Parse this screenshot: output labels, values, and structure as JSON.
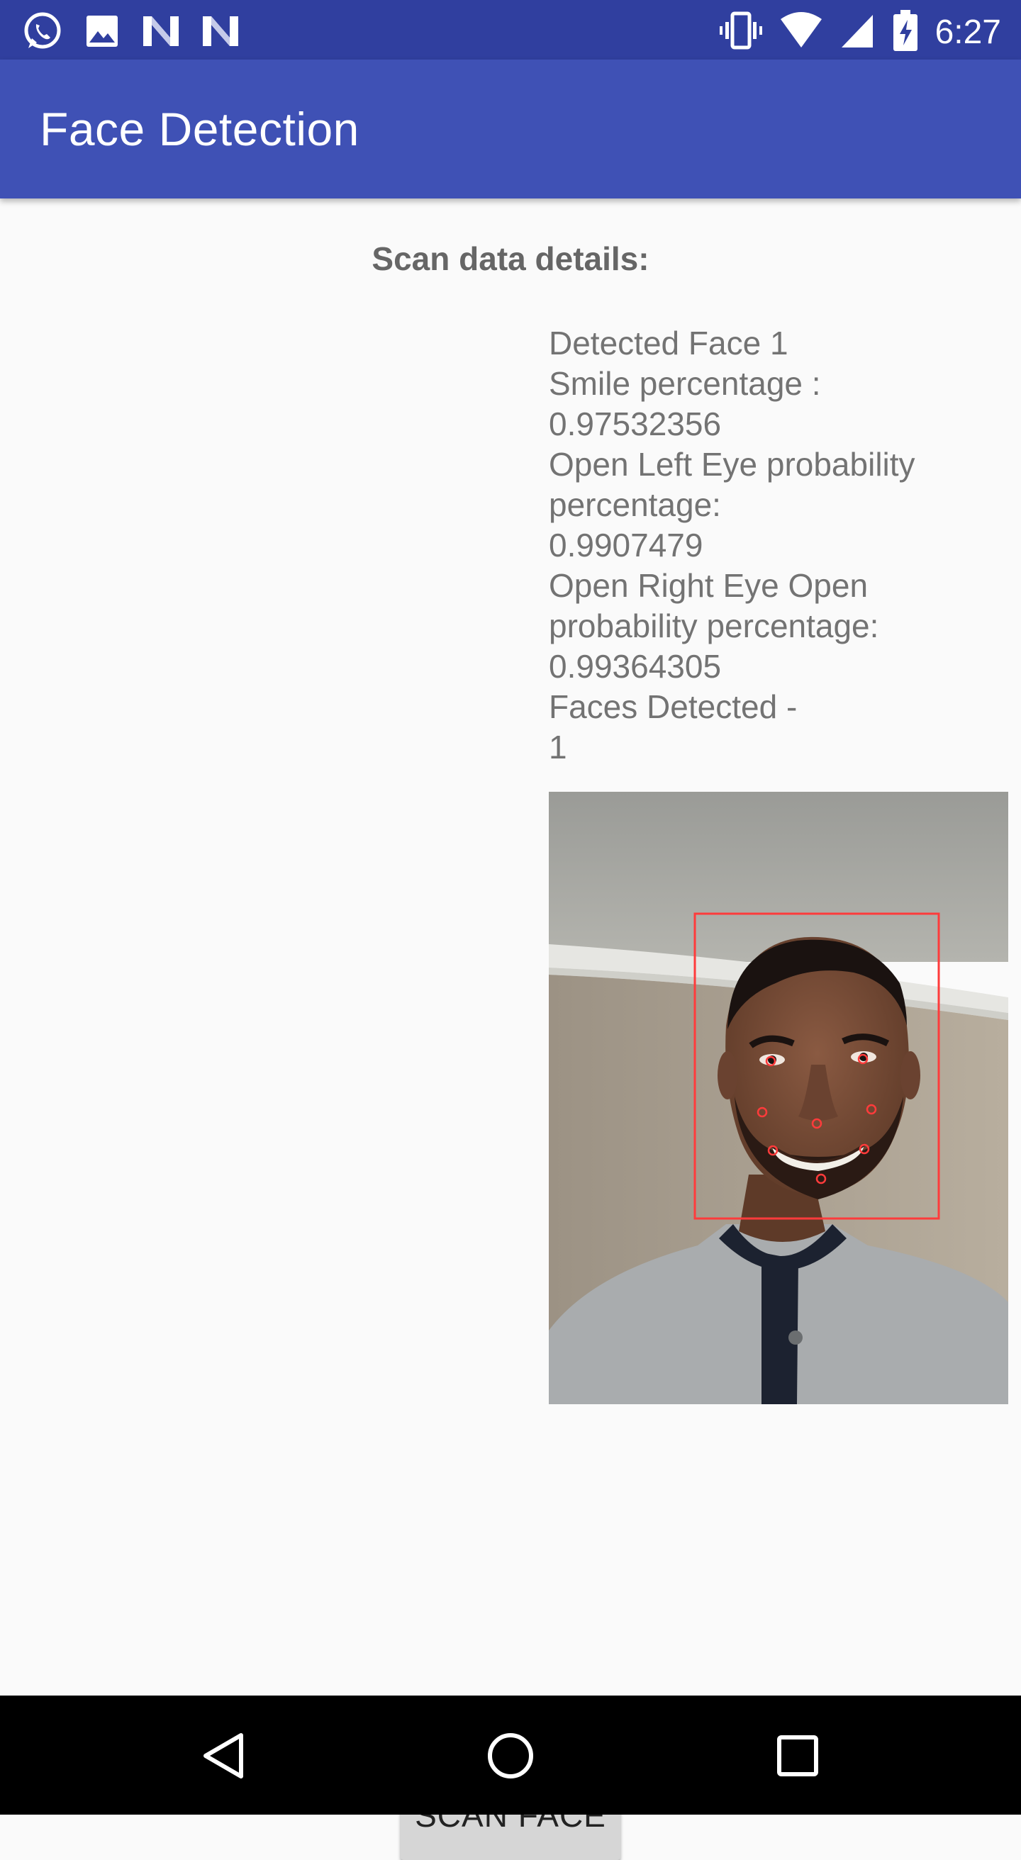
{
  "status_bar": {
    "time": "6:27",
    "left_icons": [
      "whatsapp-icon",
      "gallery-icon",
      "n-notification-icon",
      "n-notification-icon"
    ],
    "right_icons": [
      "vibrate-icon",
      "wifi-icon",
      "signal-icon",
      "battery-charging-icon"
    ]
  },
  "app_bar": {
    "title": "Face Detection",
    "color": "#3f51b5",
    "status_color": "#303f9f"
  },
  "scan": {
    "heading": "Scan data details:",
    "details_lines": [
      "Detected Face 1",
      "Smile percentage :",
      "0.97532356",
      "Open Left Eye probability",
      "percentage:",
      "0.9907479",
      "Open Right Eye Open",
      "probability percentage:",
      "0.99364305",
      "Faces Detected -",
      "1"
    ]
  },
  "photo": {
    "description_icon": "face-photo",
    "face_box_color": "#ff3b3b",
    "landmark_count": 8
  },
  "button": {
    "label": "SCAN FACE"
  },
  "nav_bar": {
    "icons": [
      "back-icon",
      "home-icon",
      "recents-icon"
    ]
  }
}
